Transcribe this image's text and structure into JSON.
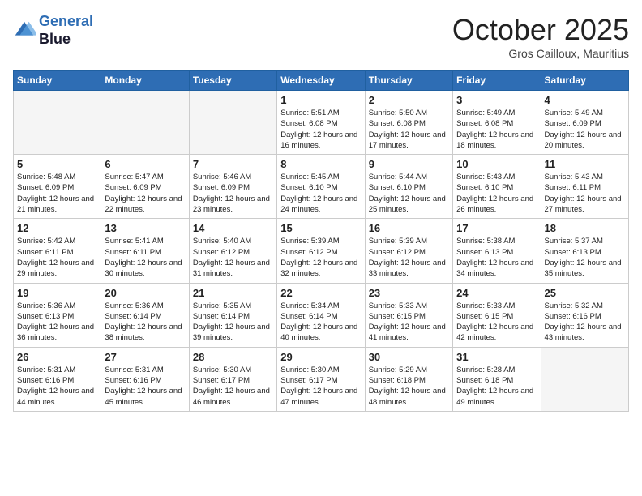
{
  "header": {
    "logo_line1": "General",
    "logo_line2": "Blue",
    "month": "October 2025",
    "location": "Gros Cailloux, Mauritius"
  },
  "weekdays": [
    "Sunday",
    "Monday",
    "Tuesday",
    "Wednesday",
    "Thursday",
    "Friday",
    "Saturday"
  ],
  "weeks": [
    [
      {
        "day": "",
        "empty": true
      },
      {
        "day": "",
        "empty": true
      },
      {
        "day": "",
        "empty": true
      },
      {
        "day": "1",
        "sunrise": "5:51 AM",
        "sunset": "6:08 PM",
        "daylight": "12 hours and 16 minutes."
      },
      {
        "day": "2",
        "sunrise": "5:50 AM",
        "sunset": "6:08 PM",
        "daylight": "12 hours and 17 minutes."
      },
      {
        "day": "3",
        "sunrise": "5:49 AM",
        "sunset": "6:08 PM",
        "daylight": "12 hours and 18 minutes."
      },
      {
        "day": "4",
        "sunrise": "5:49 AM",
        "sunset": "6:09 PM",
        "daylight": "12 hours and 20 minutes."
      }
    ],
    [
      {
        "day": "5",
        "sunrise": "5:48 AM",
        "sunset": "6:09 PM",
        "daylight": "12 hours and 21 minutes."
      },
      {
        "day": "6",
        "sunrise": "5:47 AM",
        "sunset": "6:09 PM",
        "daylight": "12 hours and 22 minutes."
      },
      {
        "day": "7",
        "sunrise": "5:46 AM",
        "sunset": "6:09 PM",
        "daylight": "12 hours and 23 minutes."
      },
      {
        "day": "8",
        "sunrise": "5:45 AM",
        "sunset": "6:10 PM",
        "daylight": "12 hours and 24 minutes."
      },
      {
        "day": "9",
        "sunrise": "5:44 AM",
        "sunset": "6:10 PM",
        "daylight": "12 hours and 25 minutes."
      },
      {
        "day": "10",
        "sunrise": "5:43 AM",
        "sunset": "6:10 PM",
        "daylight": "12 hours and 26 minutes."
      },
      {
        "day": "11",
        "sunrise": "5:43 AM",
        "sunset": "6:11 PM",
        "daylight": "12 hours and 27 minutes."
      }
    ],
    [
      {
        "day": "12",
        "sunrise": "5:42 AM",
        "sunset": "6:11 PM",
        "daylight": "12 hours and 29 minutes."
      },
      {
        "day": "13",
        "sunrise": "5:41 AM",
        "sunset": "6:11 PM",
        "daylight": "12 hours and 30 minutes."
      },
      {
        "day": "14",
        "sunrise": "5:40 AM",
        "sunset": "6:12 PM",
        "daylight": "12 hours and 31 minutes."
      },
      {
        "day": "15",
        "sunrise": "5:39 AM",
        "sunset": "6:12 PM",
        "daylight": "12 hours and 32 minutes."
      },
      {
        "day": "16",
        "sunrise": "5:39 AM",
        "sunset": "6:12 PM",
        "daylight": "12 hours and 33 minutes."
      },
      {
        "day": "17",
        "sunrise": "5:38 AM",
        "sunset": "6:13 PM",
        "daylight": "12 hours and 34 minutes."
      },
      {
        "day": "18",
        "sunrise": "5:37 AM",
        "sunset": "6:13 PM",
        "daylight": "12 hours and 35 minutes."
      }
    ],
    [
      {
        "day": "19",
        "sunrise": "5:36 AM",
        "sunset": "6:13 PM",
        "daylight": "12 hours and 36 minutes."
      },
      {
        "day": "20",
        "sunrise": "5:36 AM",
        "sunset": "6:14 PM",
        "daylight": "12 hours and 38 minutes."
      },
      {
        "day": "21",
        "sunrise": "5:35 AM",
        "sunset": "6:14 PM",
        "daylight": "12 hours and 39 minutes."
      },
      {
        "day": "22",
        "sunrise": "5:34 AM",
        "sunset": "6:14 PM",
        "daylight": "12 hours and 40 minutes."
      },
      {
        "day": "23",
        "sunrise": "5:33 AM",
        "sunset": "6:15 PM",
        "daylight": "12 hours and 41 minutes."
      },
      {
        "day": "24",
        "sunrise": "5:33 AM",
        "sunset": "6:15 PM",
        "daylight": "12 hours and 42 minutes."
      },
      {
        "day": "25",
        "sunrise": "5:32 AM",
        "sunset": "6:16 PM",
        "daylight": "12 hours and 43 minutes."
      }
    ],
    [
      {
        "day": "26",
        "sunrise": "5:31 AM",
        "sunset": "6:16 PM",
        "daylight": "12 hours and 44 minutes."
      },
      {
        "day": "27",
        "sunrise": "5:31 AM",
        "sunset": "6:16 PM",
        "daylight": "12 hours and 45 minutes."
      },
      {
        "day": "28",
        "sunrise": "5:30 AM",
        "sunset": "6:17 PM",
        "daylight": "12 hours and 46 minutes."
      },
      {
        "day": "29",
        "sunrise": "5:30 AM",
        "sunset": "6:17 PM",
        "daylight": "12 hours and 47 minutes."
      },
      {
        "day": "30",
        "sunrise": "5:29 AM",
        "sunset": "6:18 PM",
        "daylight": "12 hours and 48 minutes."
      },
      {
        "day": "31",
        "sunrise": "5:28 AM",
        "sunset": "6:18 PM",
        "daylight": "12 hours and 49 minutes."
      },
      {
        "day": "",
        "empty": true
      }
    ]
  ],
  "labels": {
    "sunrise": "Sunrise:",
    "sunset": "Sunset:",
    "daylight": "Daylight:"
  }
}
